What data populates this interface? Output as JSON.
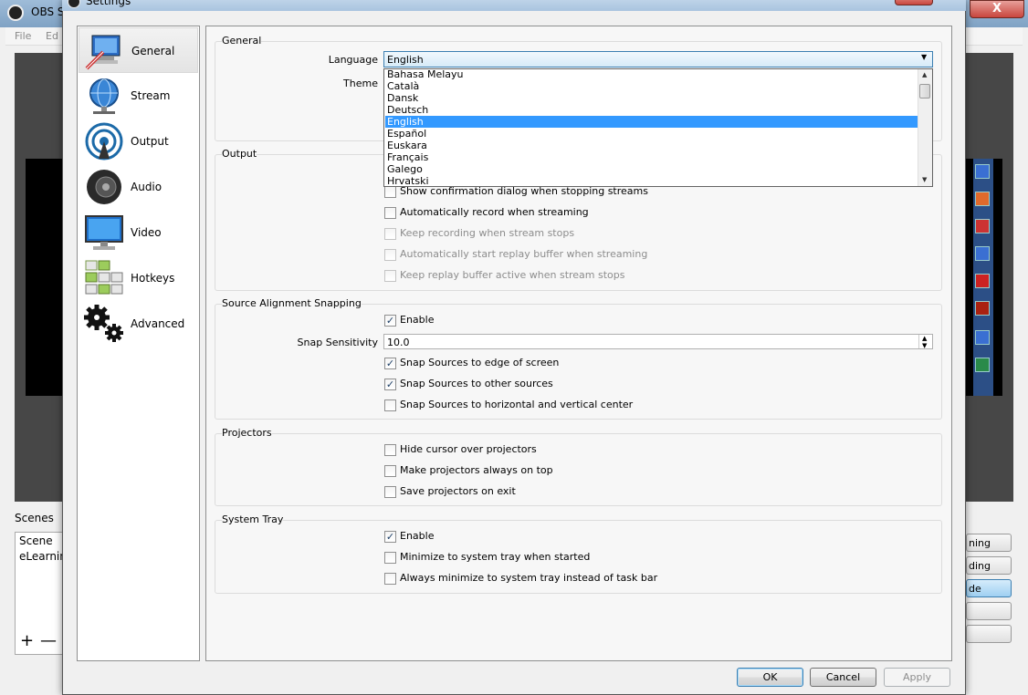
{
  "background_app": {
    "title": "OBS St",
    "menu": [
      "File",
      "Ed"
    ],
    "scenes_label": "Scenes",
    "scenes": [
      "Scene",
      "eLearnin"
    ],
    "scene_add": "+",
    "scene_remove": "—",
    "buttons": [
      "ning",
      "ding",
      "de",
      "",
      ""
    ],
    "close": "X"
  },
  "dialog": {
    "title": "Settings",
    "nav": [
      {
        "label": "General",
        "icon": "general-settings-icon"
      },
      {
        "label": "Stream",
        "icon": "stream-globe-icon"
      },
      {
        "label": "Output",
        "icon": "output-broadcast-icon"
      },
      {
        "label": "Audio",
        "icon": "speaker-icon"
      },
      {
        "label": "Video",
        "icon": "monitor-icon"
      },
      {
        "label": "Hotkeys",
        "icon": "keyboard-icon"
      },
      {
        "label": "Advanced",
        "icon": "gears-icon"
      }
    ],
    "selected_nav": "General",
    "general": {
      "title": "General",
      "language_label": "Language",
      "language_value": "English",
      "theme_label": "Theme",
      "language_options": [
        "Bahasa Melayu",
        "Català",
        "Dansk",
        "Deutsch",
        "English",
        "Español",
        "Euskara",
        "Français",
        "Galego",
        "Hrvatski"
      ],
      "selected_language": "English"
    },
    "output": {
      "title": "Output",
      "options": [
        {
          "label": "Show confirmation dialog when stopping streams",
          "checked": false,
          "disabled": false
        },
        {
          "label": "Automatically record when streaming",
          "checked": false,
          "disabled": false
        },
        {
          "label": "Keep recording when stream stops",
          "checked": false,
          "disabled": true
        },
        {
          "label": "Automatically start replay buffer when streaming",
          "checked": false,
          "disabled": true
        },
        {
          "label": "Keep replay buffer active when stream stops",
          "checked": false,
          "disabled": true
        }
      ]
    },
    "snapping": {
      "title": "Source Alignment Snapping",
      "enable": {
        "label": "Enable",
        "checked": true
      },
      "sensitivity_label": "Snap Sensitivity",
      "sensitivity_value": "10.0",
      "options": [
        {
          "label": "Snap Sources to edge of screen",
          "checked": true
        },
        {
          "label": "Snap Sources to other sources",
          "checked": true
        },
        {
          "label": "Snap Sources to horizontal and vertical center",
          "checked": false
        }
      ]
    },
    "projectors": {
      "title": "Projectors",
      "options": [
        {
          "label": "Hide cursor over projectors",
          "checked": false
        },
        {
          "label": "Make projectors always on top",
          "checked": false
        },
        {
          "label": "Save projectors on exit",
          "checked": false
        }
      ]
    },
    "tray": {
      "title": "System Tray",
      "options": [
        {
          "label": "Enable",
          "checked": true
        },
        {
          "label": "Minimize to system tray when started",
          "checked": false
        },
        {
          "label": "Always minimize to system tray instead of task bar",
          "checked": false
        }
      ]
    },
    "buttons": {
      "ok": "OK",
      "cancel": "Cancel",
      "apply": "Apply"
    }
  },
  "colors": {
    "selection": "#3399ff",
    "accent_border": "#3c7fb1"
  }
}
